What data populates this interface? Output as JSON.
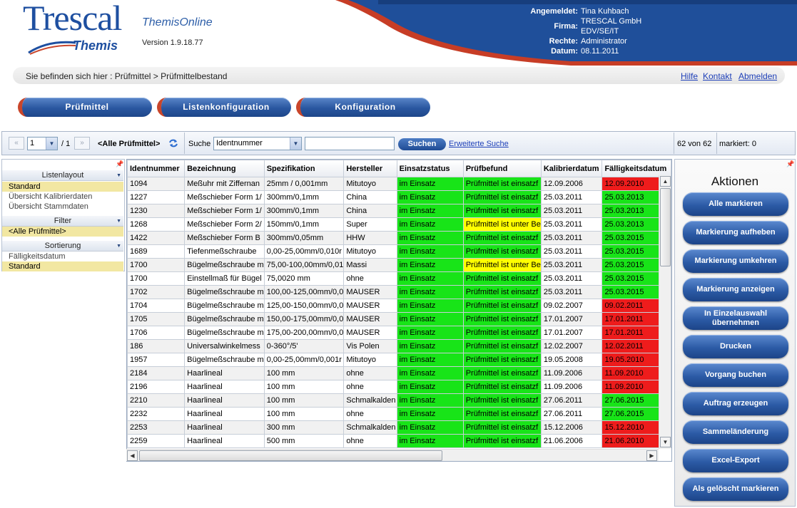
{
  "header": {
    "logo_main": "Trescal",
    "logo_sub": "Themis",
    "app_title": "ThemisOnline",
    "version": "Version 1.9.18.77",
    "user": {
      "label_user": "Angemeldet:",
      "user": "Tina Kuhbach",
      "label_company": "Firma:",
      "company_line1": "TRESCAL GmbH",
      "company_line2": "EDV/SE/IT",
      "label_rights": "Rechte:",
      "rights": "Administrator",
      "label_date": "Datum:",
      "date": "08.11.2011"
    }
  },
  "breadcrumb": "Sie befinden sich hier : Prüfmittel > Prüfmittelbestand",
  "links": {
    "help": "Hilfe",
    "contact": "Kontakt",
    "logout": "Abmelden"
  },
  "nav": [
    "Prüfmittel",
    "Listenkonfiguration",
    "Konfiguration"
  ],
  "toolbar": {
    "first_icon": "«",
    "prev_icon": "»",
    "page": "1",
    "page_total": "/ 1",
    "filter_label": "<Alle Prüfmittel>",
    "search_label": "Suche",
    "search_field": "Identnummer",
    "search_value": "",
    "search_button": "Suchen",
    "advanced": "Erweiterte Suche",
    "count": "62 von 62",
    "marked": "markiert: 0"
  },
  "left_panel": {
    "layout_header": "Listenlayout",
    "layout_items": [
      "Standard",
      "Übersicht Kalibrierdaten",
      "Übersicht Stammdaten"
    ],
    "filter_header": "Filter",
    "filter_items": [
      "<Alle Prüfmittel>"
    ],
    "sort_header": "Sortierung",
    "sort_items": [
      "Fälligkeitsdatum",
      "Standard"
    ]
  },
  "grid": {
    "columns": [
      "Identnummer",
      "Bezeichnung",
      "Spezifikation",
      "Hersteller",
      "Einsatzstatus",
      "Prüfbefund",
      "Kalibrierdatum",
      "Fälligkeitsdatum"
    ],
    "rows": [
      [
        "1094",
        "Meßuhr mit Ziffernan",
        "25mm / 0,001mm",
        "Mitutoyo",
        "im Einsatz",
        "Prüfmittel ist einsatzf",
        "12.09.2006",
        "12.09.2010"
      ],
      [
        "1227",
        "Meßschieber Form 1/",
        "300mm/0,1mm",
        "China",
        "im Einsatz",
        "Prüfmittel ist einsatzf",
        "25.03.2011",
        "25.03.2013"
      ],
      [
        "1230",
        "Meßschieber Form 1/",
        "300mm/0,1mm",
        "China",
        "im Einsatz",
        "Prüfmittel ist einsatzf",
        "25.03.2011",
        "25.03.2013"
      ],
      [
        "1268",
        "Meßschieber Form 2/",
        "150mm/0,1mm",
        "Super",
        "im Einsatz",
        "Prüfmittel ist unter Be",
        "25.03.2011",
        "25.03.2013"
      ],
      [
        "1422",
        "Meßschieber Form B",
        "300mm/0,05mm",
        "HHW",
        "im Einsatz",
        "Prüfmittel ist einsatzf",
        "25.03.2011",
        "25.03.2015"
      ],
      [
        "1689",
        "Tiefenmeßschraube",
        "0,00-25,00mm/0,010r",
        "Mitutoyo",
        "im Einsatz",
        "Prüfmittel ist einsatzf",
        "25.03.2011",
        "25.03.2015"
      ],
      [
        "1700",
        "Bügelmeßschraube m",
        "75,00-100,00mm/0,01",
        "Massi",
        "im Einsatz",
        "Prüfmittel ist unter Be",
        "25.03.2011",
        "25.03.2015"
      ],
      [
        "1700",
        "Einstellmaß für Bügel",
        "75,0020 mm",
        "ohne",
        "im Einsatz",
        "Prüfmittel ist einsatzf",
        "25.03.2011",
        "25.03.2015"
      ],
      [
        "1702",
        "Bügelmeßschraube m",
        "100,00-125,00mm/0,0",
        "MAUSER",
        "im Einsatz",
        "Prüfmittel ist einsatzf",
        "25.03.2011",
        "25.03.2015"
      ],
      [
        "1704",
        "Bügelmeßschraube m",
        "125,00-150,00mm/0,0",
        "MAUSER",
        "im Einsatz",
        "Prüfmittel ist einsatzf",
        "09.02.2007",
        "09.02.2011"
      ],
      [
        "1705",
        "Bügelmeßschraube m",
        "150,00-175,00mm/0,0",
        "MAUSER",
        "im Einsatz",
        "Prüfmittel ist einsatzf",
        "17.01.2007",
        "17.01.2011"
      ],
      [
        "1706",
        "Bügelmeßschraube m",
        "175,00-200,00mm/0,0",
        "MAUSER",
        "im Einsatz",
        "Prüfmittel ist einsatzf",
        "17.01.2007",
        "17.01.2011"
      ],
      [
        "186",
        "Universalwinkelmess",
        "0-360°/5'",
        "Vis Polen",
        "im Einsatz",
        "Prüfmittel ist einsatzf",
        "12.02.2007",
        "12.02.2011"
      ],
      [
        "1957",
        "Bügelmeßschraube m",
        "0,00-25,00mm/0,001r",
        "Mitutoyo",
        "im Einsatz",
        "Prüfmittel ist einsatzf",
        "19.05.2008",
        "19.05.2010"
      ],
      [
        "2184",
        "Haarlineal",
        "100 mm",
        "ohne",
        "im Einsatz",
        "Prüfmittel ist einsatzf",
        "11.09.2006",
        "11.09.2010"
      ],
      [
        "2196",
        "Haarlineal",
        "100 mm",
        "ohne",
        "im Einsatz",
        "Prüfmittel ist einsatzf",
        "11.09.2006",
        "11.09.2010"
      ],
      [
        "2210",
        "Haarlineal",
        "100 mm",
        "Schmalkalden",
        "im Einsatz",
        "Prüfmittel ist einsatzf",
        "27.06.2011",
        "27.06.2015"
      ],
      [
        "2232",
        "Haarlineal",
        "100 mm",
        "ohne",
        "im Einsatz",
        "Prüfmittel ist einsatzf",
        "27.06.2011",
        "27.06.2015"
      ],
      [
        "2253",
        "Haarlineal",
        "300 mm",
        "Schmalkalden",
        "im Einsatz",
        "Prüfmittel ist einsatzf",
        "15.12.2006",
        "15.12.2010"
      ],
      [
        "2259",
        "Haarlineal",
        "500 mm",
        "ohne",
        "im Einsatz",
        "Prüfmittel ist einsatzf",
        "21.06.2006",
        "21.06.2010"
      ]
    ],
    "befund_colors": [
      "green",
      "green",
      "green",
      "yellow",
      "green",
      "green",
      "yellow",
      "green",
      "green",
      "green",
      "green",
      "green",
      "green",
      "green",
      "green",
      "green",
      "green",
      "green",
      "green",
      "green"
    ],
    "due_colors": [
      "red",
      "green",
      "green",
      "green",
      "green",
      "green",
      "green",
      "green",
      "green",
      "red",
      "red",
      "red",
      "red",
      "red",
      "red",
      "red",
      "green",
      "green",
      "red",
      "red"
    ]
  },
  "actions": {
    "title": "Aktionen",
    "buttons": [
      "Alle markieren",
      "Markierung aufheben",
      "Markierung umkehren",
      "Markierung anzeigen",
      "In Einzelauswahl übernehmen",
      "Drucken",
      "Vorgang buchen",
      "Auftrag erzeugen",
      "Sammeländerung",
      "Excel-Export",
      "Als gelöscht markieren"
    ]
  },
  "colors": {
    "brand_blue": "#1e4fa0",
    "accent_red": "#c9462b",
    "ok_green": "#18e418",
    "due_red": "#ee1c1c",
    "warn_yellow": "#ffff00"
  },
  "icons": {
    "refresh": "refresh-icon",
    "pin": "pin-icon",
    "dropdown": "chevron-down-icon"
  }
}
